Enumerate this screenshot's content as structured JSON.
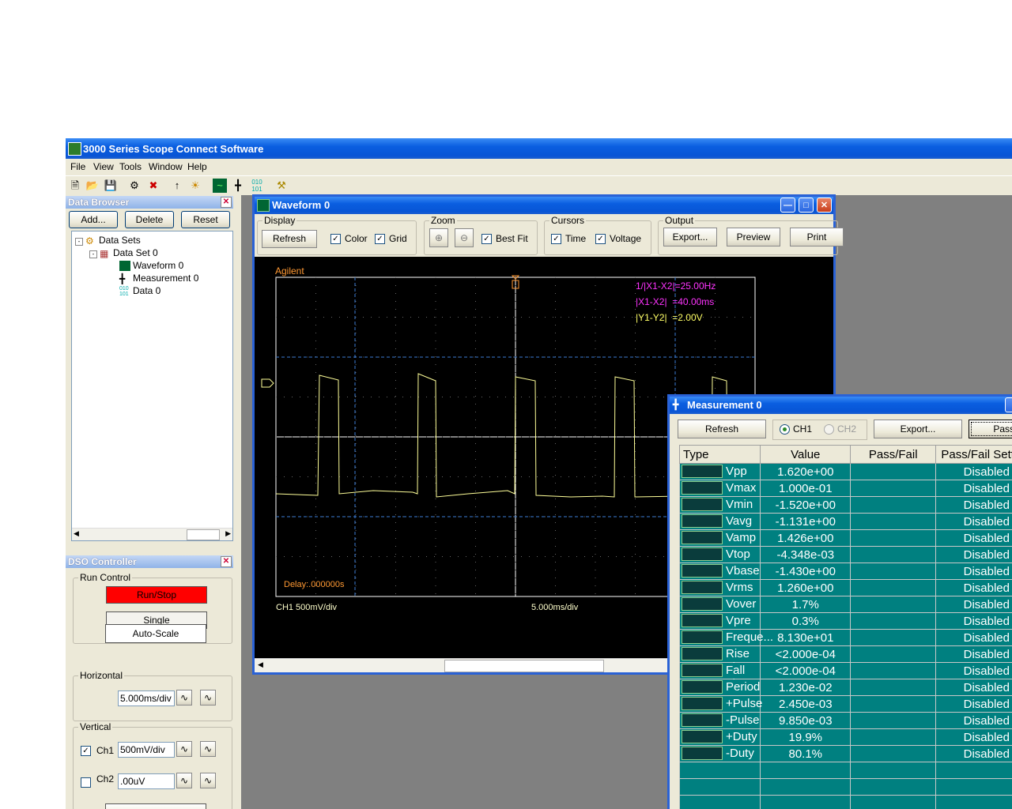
{
  "app": {
    "title": "3000 Series Scope Connect Software"
  },
  "menu": [
    "File",
    "View",
    "Tools",
    "Window",
    "Help"
  ],
  "data_browser": {
    "title": "Data Browser",
    "add": "Add...",
    "delete": "Delete",
    "reset": "Reset",
    "tree": {
      "root": "Data Sets",
      "set": "Data Set 0",
      "items": [
        "Waveform 0",
        "Measurement 0",
        "Data 0"
      ]
    }
  },
  "dso": {
    "title": "DSO Controller",
    "run_control": "Run Control",
    "run_stop": "Run/Stop",
    "single": "Single",
    "auto_scale": "Auto-Scale",
    "horizontal": "Horizontal",
    "h_value": "5.000ms/div",
    "vertical": "Vertical",
    "ch1": "Ch1",
    "ch1_value": "500mV/div",
    "ch2": "Ch2",
    "ch2_value": ".00uV",
    "run_color": "#ff0000"
  },
  "waveform": {
    "title": "Waveform 0",
    "display": "Display",
    "refresh": "Refresh",
    "color": "Color",
    "grid": "Grid",
    "zoom": "Zoom",
    "best_fit": "Best Fit",
    "cursors": "Cursors",
    "time": "Time",
    "voltage": "Voltage",
    "output": "Output",
    "export": "Export...",
    "preview": "Preview",
    "print": "Print",
    "screen": {
      "brand": "Agilent",
      "cur1": "1/|X1-X2|=25.00Hz",
      "cur2": "|X1-X2|  =40.00ms",
      "cur3": "|Y1-Y2|  =2.00V",
      "delay": "Delay:.000000s",
      "ch_scale": "CH1 500mV/div",
      "time_scale": "5.000ms/div"
    }
  },
  "measurement": {
    "title": "Measurement 0",
    "refresh": "Refresh",
    "ch1": "CH1",
    "ch2": "CH2",
    "export": "Export...",
    "passfail": "Pass/Fail",
    "headers": [
      "Type",
      "Value",
      "Pass/Fail",
      "Pass/Fail Sett"
    ],
    "rows": [
      {
        "type": "Vpp",
        "value": "1.620e+00",
        "setting": "Disabled"
      },
      {
        "type": "Vmax",
        "value": "1.000e-01",
        "setting": "Disabled"
      },
      {
        "type": "Vmin",
        "value": "-1.520e+00",
        "setting": "Disabled"
      },
      {
        "type": "Vavg",
        "value": "-1.131e+00",
        "setting": "Disabled"
      },
      {
        "type": "Vamp",
        "value": "1.426e+00",
        "setting": "Disabled"
      },
      {
        "type": "Vtop",
        "value": "-4.348e-03",
        "setting": "Disabled"
      },
      {
        "type": "Vbase",
        "value": "-1.430e+00",
        "setting": "Disabled"
      },
      {
        "type": "Vrms",
        "value": "1.260e+00",
        "setting": "Disabled"
      },
      {
        "type": "Vover",
        "value": "1.7%",
        "setting": "Disabled"
      },
      {
        "type": "Vpre",
        "value": "0.3%",
        "setting": "Disabled"
      },
      {
        "type": "Freque...",
        "value": "8.130e+01",
        "setting": "Disabled"
      },
      {
        "type": "Rise Time",
        "value": "<2.000e-04",
        "setting": "Disabled"
      },
      {
        "type": "Fall Time",
        "value": "<2.000e-04",
        "setting": "Disabled"
      },
      {
        "type": "Period",
        "value": "1.230e-02",
        "setting": "Disabled"
      },
      {
        "type": "+Pulse ...",
        "value": "2.450e-03",
        "setting": "Disabled"
      },
      {
        "type": "-Pulse ...",
        "value": "9.850e-03",
        "setting": "Disabled"
      },
      {
        "type": "+Duty",
        "value": "19.9%",
        "setting": "Disabled"
      },
      {
        "type": "-Duty",
        "value": "80.1%",
        "setting": "Disabled"
      }
    ]
  }
}
